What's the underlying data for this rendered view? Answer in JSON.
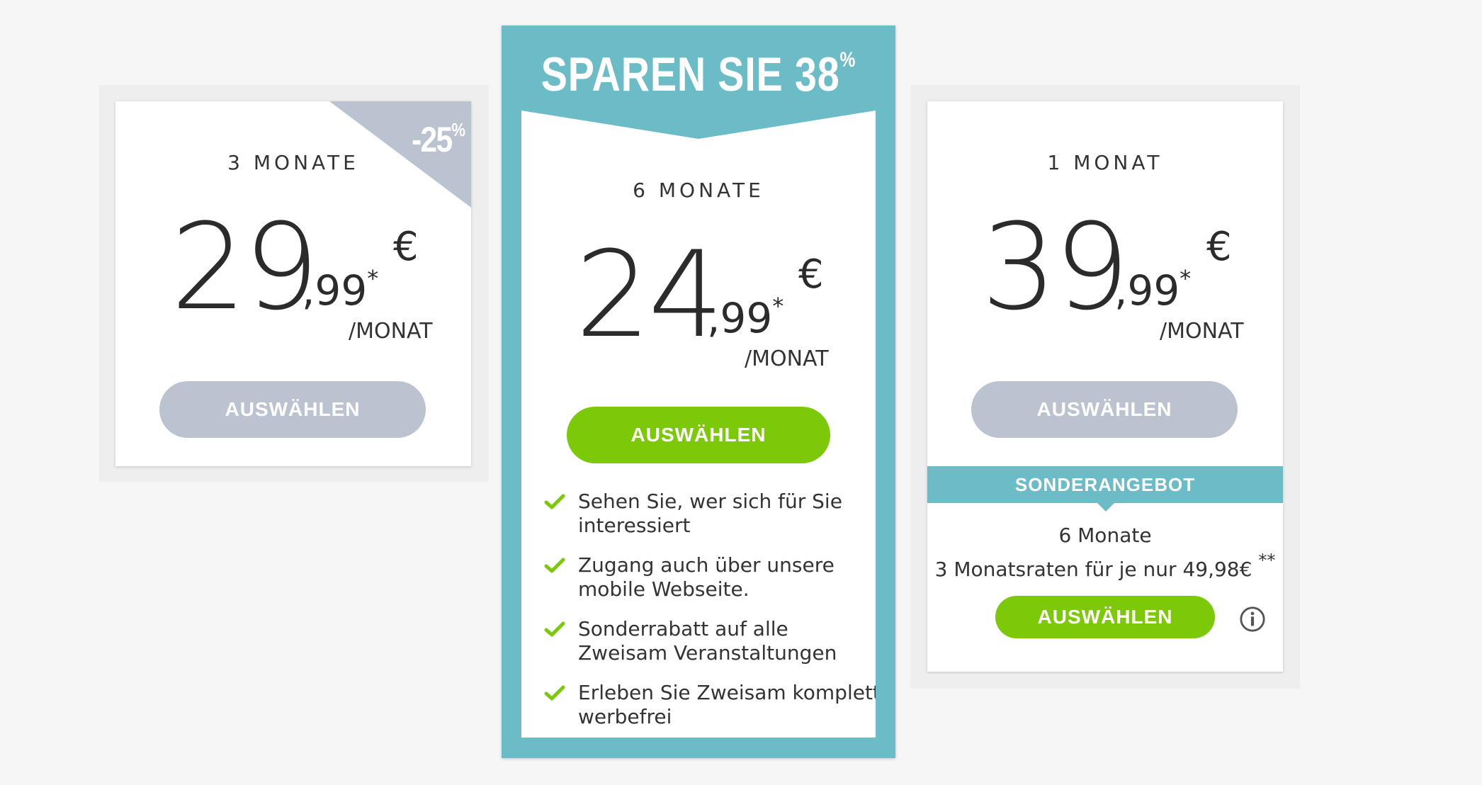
{
  "plans": [
    {
      "period": "3 MONATE",
      "badge": "-25",
      "badge_suffix": "%",
      "price_int": "29",
      "price_dec": ",99",
      "price_mark": "*",
      "currency": "€",
      "per": "/MONAT",
      "button": "AUSWÄHLEN"
    },
    {
      "banner": "SPAREN SIE 38",
      "banner_suffix": "%",
      "period": "6 MONATE",
      "price_int": "24",
      "price_dec": ",99",
      "price_mark": "*",
      "currency": "€",
      "per": "/MONAT",
      "button": "AUSWÄHLEN",
      "features": [
        "Sehen Sie, wer sich für Sie interessiert",
        "Zugang auch über unsere mobile Webseite.",
        "Sonderrabatt auf alle Zweisam Veranstaltungen",
        "Erleben Sie Zweisam komplett werbefrei"
      ]
    },
    {
      "period": "1 MONAT",
      "price_int": "39",
      "price_dec": ",99",
      "price_mark": "*",
      "currency": "€",
      "per": "/MONAT",
      "button": "AUSWÄHLEN",
      "offer": {
        "label": "SONDERANGEBOT",
        "line1": "6 Monate",
        "line2": "3 Monatsraten für je nur 49,98€",
        "line2_mark": "**",
        "button": "AUSWÄHLEN",
        "icon": "info-icon"
      }
    }
  ],
  "colors": {
    "teal": "#6bbcc6",
    "green": "#7cc90a",
    "grey_button": "#bcc3d0",
    "background": "#f6f6f6"
  }
}
